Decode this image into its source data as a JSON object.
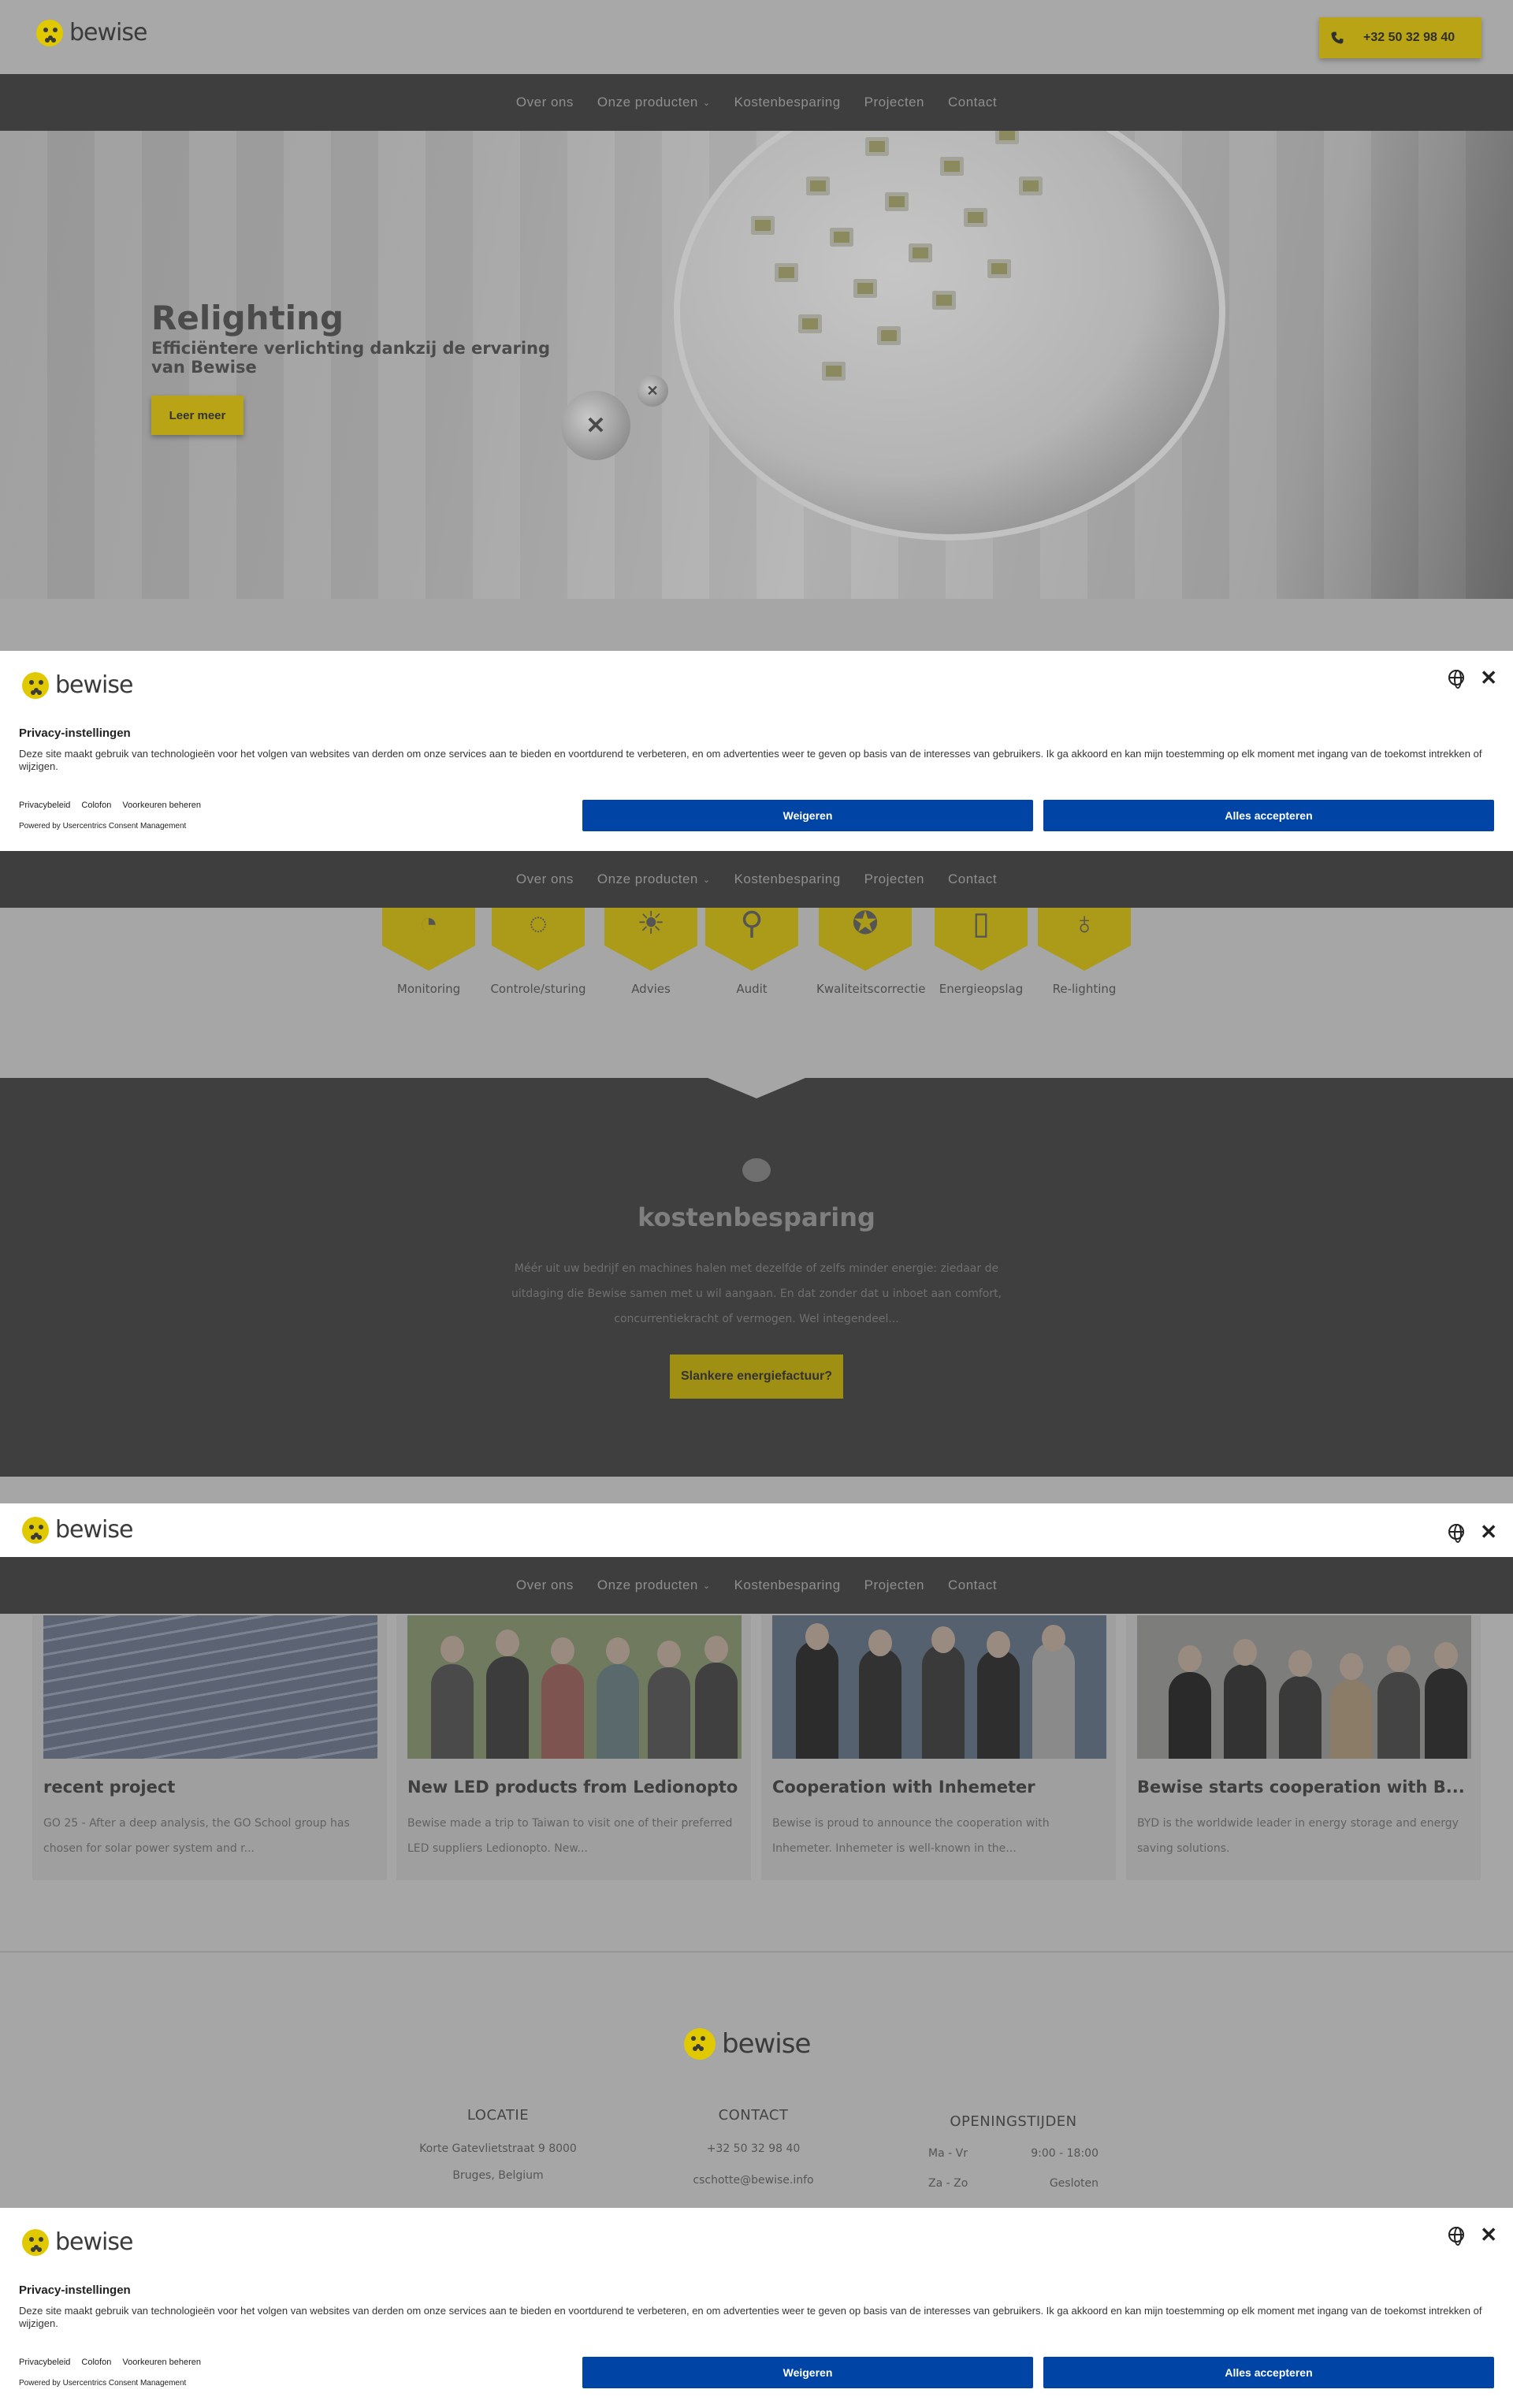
{
  "brand": {
    "name": "bewise",
    "accent": "#e0c900",
    "consent_button_color": "#0045a5"
  },
  "header": {
    "phone": "+32 50 32 98 40"
  },
  "nav": {
    "items": [
      {
        "label": "Over ons"
      },
      {
        "label": "Onze producten"
      },
      {
        "label": "Kostenbesparing"
      },
      {
        "label": "Projecten"
      },
      {
        "label": "Contact"
      }
    ]
  },
  "hero": {
    "title": "Relighting",
    "subtitle": "Efficiëntere verlichting dankzij de ervaring van Bewise",
    "button": "Leer meer"
  },
  "services": [
    {
      "label": "Monitoring",
      "icon": "monitoring-icon"
    },
    {
      "label": "Controle/sturing",
      "icon": "control-icon"
    },
    {
      "label": "Advies",
      "icon": "bulb-icon"
    },
    {
      "label": "Audit",
      "icon": "magnifier-icon"
    },
    {
      "label": "Kwaliteitscorrectie",
      "icon": "award-icon"
    },
    {
      "label": "Energieopslag",
      "icon": "battery-icon"
    },
    {
      "label": "Re-lighting",
      "icon": "lightbulb-icon"
    }
  ],
  "savings": {
    "title": "kostenbesparing",
    "text": "Méér uit uw bedrijf en machines halen met dezelfde of zelfs minder energie: ziedaar de uitdaging die Bewise samen met u wil aangaan. En dat zonder dat u inboet aan comfort, concurrentiekracht of vermogen. Wel integendeel...",
    "button": "Slankere energiefactuur?"
  },
  "projects": [
    {
      "title": "recent project",
      "text": "GO 25 - After a deep analysis, the GO School group has chosen for solar power system and r..."
    },
    {
      "title": "New LED products from Ledionopto",
      "text": "Bewise made a trip to Taiwan to visit one of their preferred LED suppliers Ledionopto. New..."
    },
    {
      "title": "Cooperation with Inhemeter",
      "text": "Bewise is proud to announce the cooperation with Inhemeter. Inhemeter is well-known in the..."
    },
    {
      "title": "Bewise starts cooperation with B...",
      "text": "BYD is the worldwide leader in energy storage and energy saving solutions."
    }
  ],
  "footer": {
    "location": {
      "heading": "LOCATIE",
      "line1": "Korte Gatevlietstraat 9 8000",
      "line2": "Bruges, Belgium"
    },
    "contact": {
      "heading": "CONTACT",
      "phone": "+32 50 32 98 40",
      "email": "cschotte@bewise.info"
    },
    "hours": {
      "heading": "OPENINGSTIJDEN",
      "rows": [
        {
          "day": "Ma - Vr",
          "time": "9:00 - 18:00"
        },
        {
          "day": "Za - Zo",
          "time": "Gesloten"
        }
      ]
    }
  },
  "consent": {
    "title": "Privacy-instellingen",
    "text": "Deze site maakt gebruik van technologieën voor het volgen van websites van derden om onze services aan te bieden en voortdurend te verbeteren, en om advertenties weer te geven op basis van de interesses van gebruikers. Ik ga akkoord en kan mijn toestemming op elk moment met ingang van de toekomst intrekken of wijzigen.",
    "links": [
      "Privacybeleid",
      "Colofon",
      "Voorkeuren beheren"
    ],
    "powered": "Powered by Usercentrics Consent Management",
    "deny": "Weigeren",
    "accept": "Alles accepteren"
  }
}
